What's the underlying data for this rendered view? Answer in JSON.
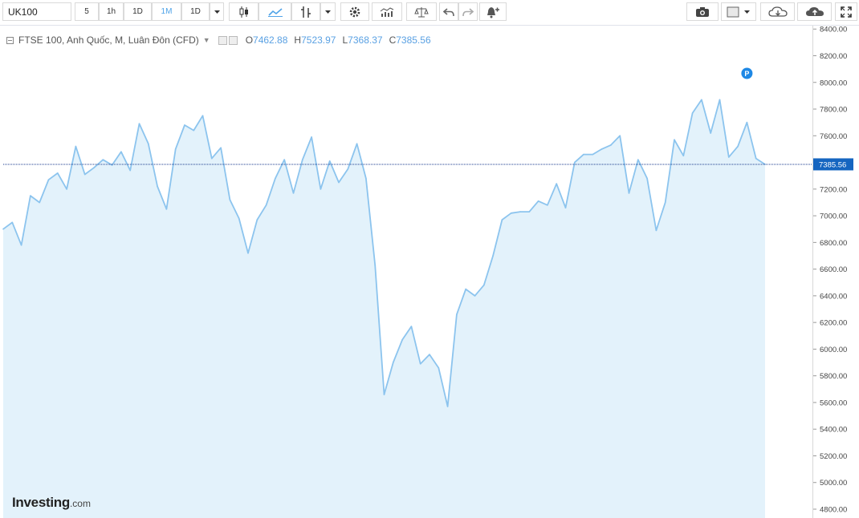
{
  "toolbar": {
    "symbol": "UK100",
    "intervals": [
      "5",
      "1h",
      "1D",
      "1M",
      "1D"
    ],
    "active_interval": "1M",
    "icons": [
      "candlestick-icon",
      "area-chart-icon",
      "indicator-icon",
      "settings-gear-icon",
      "volume-bars-icon",
      "compare-scales-icon",
      "undo-icon",
      "redo-icon",
      "alert-bell-icon",
      "camera-icon",
      "color-square-icon",
      "cloud-load-icon",
      "cloud-save-icon",
      "fullscreen-icon"
    ]
  },
  "legend": {
    "title": "FTSE 100, Anh Quốc, M, Luân Đôn (CFD)",
    "open_label": "O",
    "open": "7462.88",
    "high_label": "H",
    "high": "7523.97",
    "low_label": "L",
    "low": "7368.37",
    "close_label": "C",
    "close": "7385.56"
  },
  "watermark": {
    "brand": "Investing",
    "domain": ".com"
  },
  "marker_label": "P",
  "colors": {
    "line": "#8cc4ee",
    "fill": "#e3f2fb",
    "price_tag": "#1565c0",
    "accent": "#4fa3e8",
    "dotted_line": "#1a3a8c"
  },
  "chart_data": {
    "type": "area",
    "title": "FTSE 100, Anh Quốc, M, Luân Đôn (CFD)",
    "ylim": [
      4700,
      8450
    ],
    "yticks": [
      "4800.00",
      "5000.00",
      "5200.00",
      "5400.00",
      "5600.00",
      "5800.00",
      "6000.00",
      "6200.00",
      "6400.00",
      "6600.00",
      "6800.00",
      "7000.00",
      "7200.00",
      "7400.00",
      "7600.00",
      "7800.00",
      "8000.00",
      "8200.00",
      "8400.00"
    ],
    "last_price": 7385.56,
    "last_price_label": "7385.56",
    "marker_index": 82,
    "values": [
      6900,
      6950,
      6780,
      7150,
      7100,
      7270,
      7320,
      7200,
      7520,
      7310,
      7360,
      7420,
      7380,
      7480,
      7340,
      7690,
      7540,
      7220,
      7050,
      7500,
      7680,
      7640,
      7750,
      7430,
      7510,
      7120,
      6980,
      6720,
      6970,
      7080,
      7280,
      7420,
      7170,
      7420,
      7590,
      7200,
      7410,
      7250,
      7350,
      7540,
      7280,
      6630,
      5660,
      5900,
      6070,
      6170,
      5890,
      5960,
      5860,
      5570,
      6260,
      6450,
      6400,
      6480,
      6700,
      6970,
      7020,
      7030,
      7030,
      7110,
      7080,
      7240,
      7060,
      7400,
      7460,
      7460,
      7500,
      7530,
      7600,
      7170,
      7420,
      7280,
      6890,
      7100,
      7570,
      7450,
      7770,
      7870,
      7620,
      7870,
      7440,
      7520,
      7700,
      7430,
      7385.56
    ]
  }
}
